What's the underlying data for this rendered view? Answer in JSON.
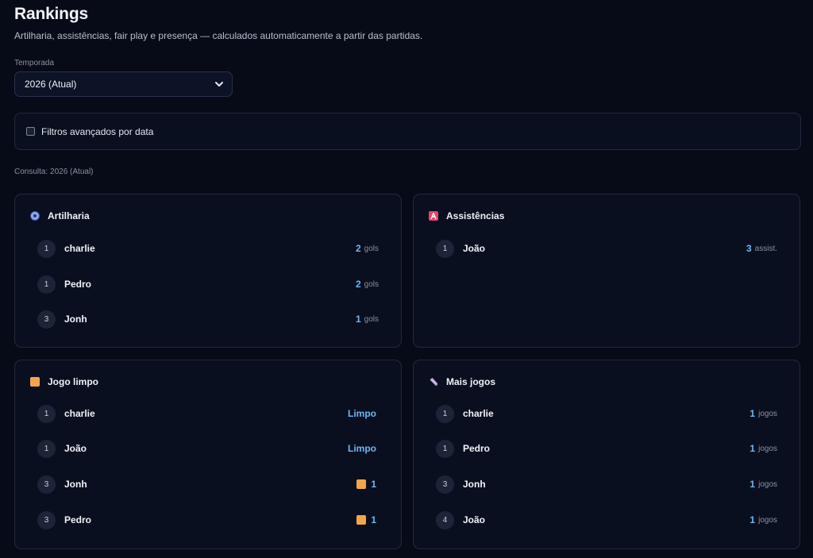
{
  "header": {
    "title": "Rankings",
    "subtitle": "Artilharia, assistências, fair play e presença — calculados automaticamente a partir das partidas."
  },
  "season": {
    "label": "Temporada",
    "selected": "2026 (Atual)"
  },
  "filters": {
    "label": "Filtros avançados por data",
    "checked": false
  },
  "query": "Consulta: 2026 (Atual)",
  "cards": {
    "scorers": {
      "title": "Artilharia",
      "icon": "soccer-ball-icon",
      "unit": "gols",
      "rows": [
        {
          "rank": "1",
          "name": "charlie",
          "value": "2"
        },
        {
          "rank": "1",
          "name": "Pedro",
          "value": "2"
        },
        {
          "rank": "3",
          "name": "Jonh",
          "value": "1"
        }
      ]
    },
    "assists": {
      "title": "Assistências",
      "icon": "letter-a-icon",
      "unit": "assist.",
      "rows": [
        {
          "rank": "1",
          "name": "João",
          "value": "3"
        }
      ]
    },
    "fairplay": {
      "title": "Jogo limpo",
      "icon": "yellow-card-icon",
      "rows": [
        {
          "rank": "1",
          "name": "charlie",
          "value": "Limpo"
        },
        {
          "rank": "1",
          "name": "João",
          "value": "Limpo"
        },
        {
          "rank": "3",
          "name": "Jonh",
          "value": "1"
        },
        {
          "rank": "3",
          "name": "Pedro",
          "value": "1"
        }
      ]
    },
    "games": {
      "title": "Mais jogos",
      "icon": "boot-icon",
      "unit": "jogos",
      "rows": [
        {
          "rank": "1",
          "name": "charlie",
          "value": "1"
        },
        {
          "rank": "1",
          "name": "Pedro",
          "value": "1"
        },
        {
          "rank": "3",
          "name": "Jonh",
          "value": "1"
        },
        {
          "rank": "4",
          "name": "João",
          "value": "1"
        }
      ]
    }
  },
  "colors": {
    "background": "#070a17",
    "card": "#0a0f20",
    "accent": "#6fb6f0",
    "yellow_card": "#f2a64a"
  }
}
